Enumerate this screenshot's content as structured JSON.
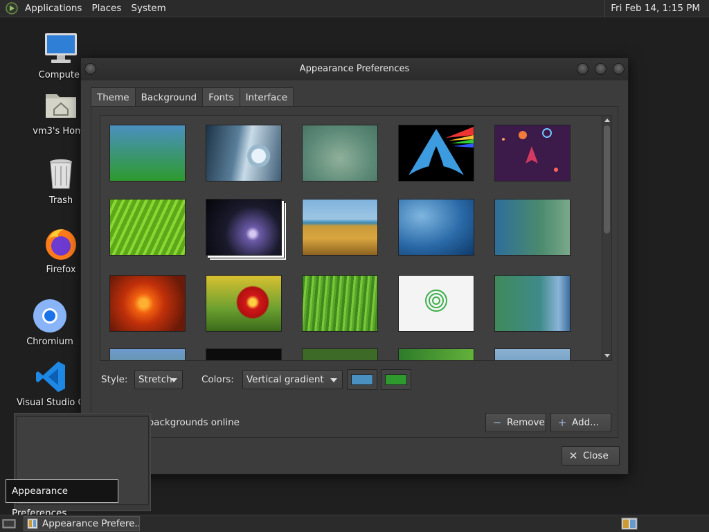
{
  "top_panel": {
    "menus": [
      "Applications",
      "Places",
      "System"
    ],
    "clock": "Fri Feb 14,  1:15 PM"
  },
  "desktop": {
    "icons": [
      {
        "label": "Computer",
        "icon": "computer-icon"
      },
      {
        "label": "vm3's Home",
        "icon": "home-folder-icon"
      },
      {
        "label": "Trash",
        "icon": "trash-icon"
      },
      {
        "label": "Firefox",
        "icon": "firefox-icon"
      },
      {
        "label": "Chromium",
        "icon": "chromium-icon"
      },
      {
        "label": "Visual Studio Code",
        "icon": "vscode-icon"
      }
    ]
  },
  "window": {
    "title": "Appearance Preferences",
    "tabs": [
      "Theme",
      "Background",
      "Fonts",
      "Interface"
    ],
    "active_tab": "Background",
    "style_label": "Style:",
    "style_value": "Stretch",
    "colors_label": "Colors:",
    "colors_value": "Vertical gradient",
    "color1": "#4a90c0",
    "color2": "#2e9a2e",
    "online_link": "Get more backgrounds online",
    "remove_label": "Remove",
    "add_label": "Add...",
    "close_label": "Close"
  },
  "tooltip": "Appearance Preferences",
  "taskbar": {
    "task_label": "Appearance Prefere..."
  }
}
